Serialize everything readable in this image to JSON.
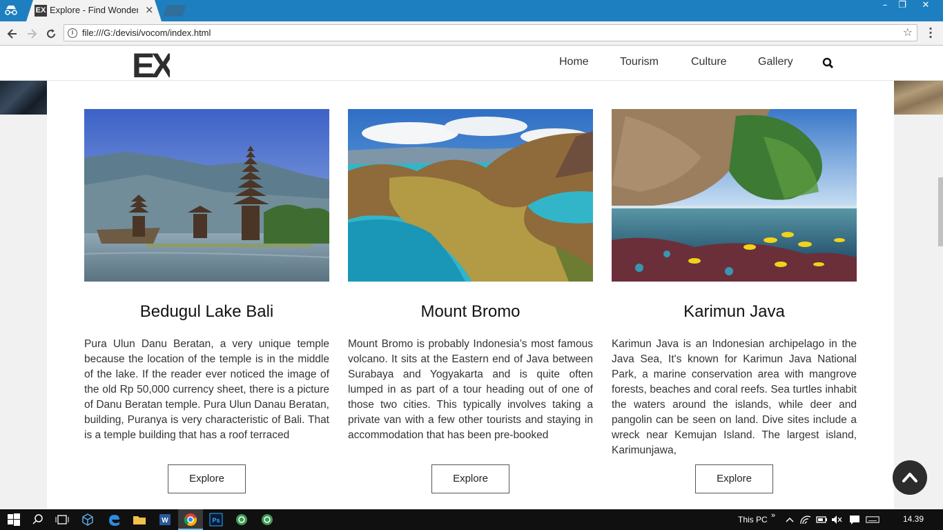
{
  "browser": {
    "tab_title": "Explore - Find Wonderful",
    "tab_favicon": "EX",
    "tab_close": "×",
    "url": "file:///G:/devisi/vocom/index.html",
    "window_controls": [
      "–",
      "❐",
      "✕"
    ]
  },
  "site": {
    "logo_text": "EX",
    "nav": [
      "Home",
      "Tourism",
      "Culture",
      "Gallery"
    ]
  },
  "cards": [
    {
      "title": "Bedugul Lake Bali",
      "text": "Pura Ulun Danu Beratan, a very unique temple because the location of the temple is in the middle of the lake. If the reader ever noticed the image of the old Rp 50,000 currency sheet, there is a picture of Danu Beratan temple. Pura Ulun Danau Beratan, building, Puranya is very characteristic of Bali. That is a temple building that has a roof terraced",
      "button": "Explore"
    },
    {
      "title": "Mount Bromo",
      "text": "Mount Bromo is probably Indonesia’s most famous volcano. It sits at the Eastern end of Java between Surabaya and Yogyakarta and is quite often lumped in as part of a tour heading out of one of those two cities. This typically involves taking a private van with a few other tourists and staying in accommodation that has been pre-booked",
      "button": "Explore"
    },
    {
      "title": "Karimun Java",
      "text": "Karimun Java is an Indonesian archipelago in the Java Sea, It's known for Karimun Java National Park, a marine conservation area with mangrove forests, beaches and coral reefs. Sea turtles inhabit the waters around the islands, while deer and pangolin can be seen on land. Dive sites include a wreck near Kemujan Island. The largest island, Karimunjawa,",
      "button": "Explore"
    }
  ],
  "taskbar": {
    "this_pc": "This PC",
    "time": "14.39"
  },
  "icons": [
    "incognito-icon",
    "back-icon",
    "forward-icon",
    "reload-icon",
    "info-icon",
    "star-icon",
    "menu-icon",
    "search-icon",
    "chevron-up-icon",
    "windows-icon"
  ]
}
